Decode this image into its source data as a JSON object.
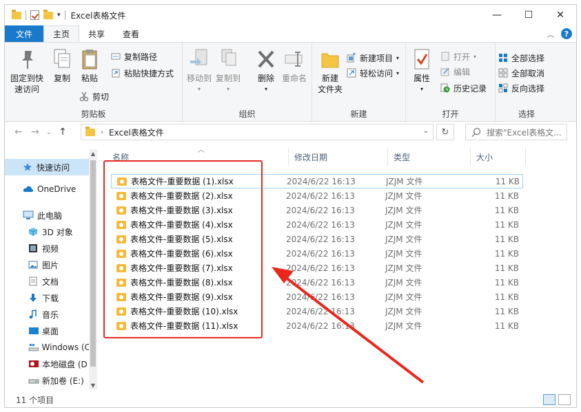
{
  "window": {
    "title": "Excel表格文件"
  },
  "window_controls": {
    "minimize": "—",
    "maximize": "☐",
    "close": "✕"
  },
  "tabs": {
    "file": "文件",
    "home": "主页",
    "share": "共享",
    "view": "查看"
  },
  "ribbon": {
    "clipboard": {
      "label": "剪贴板",
      "pin": "固定到快速访问",
      "pin_line1": "固定到快",
      "pin_line2": "速访问",
      "copy": "复制",
      "paste": "粘贴",
      "copy_path": "复制路径",
      "paste_shortcut": "粘贴快捷方式",
      "cut": "剪切"
    },
    "organize": {
      "label": "组织",
      "move_to": "移动到",
      "copy_to": "复制到",
      "delete": "删除",
      "rename": "重命名"
    },
    "new": {
      "label": "新建",
      "new_folder_line1": "新建",
      "new_folder_line2": "文件夹",
      "new_item": "新建项目",
      "easy_access": "轻松访问"
    },
    "open": {
      "label": "打开",
      "properties": "属性",
      "open": "打开",
      "edit": "编辑",
      "history": "历史记录"
    },
    "select": {
      "label": "选择",
      "select_all": "全部选择",
      "select_none": "全部取消",
      "invert": "反向选择"
    }
  },
  "address": {
    "path": "Excel表格文件",
    "search_placeholder": "搜索\"Excel表格文..."
  },
  "nav": {
    "items": [
      {
        "label": "快速访问",
        "icon": "star-icon"
      },
      {
        "label": "OneDrive",
        "icon": "cloud-icon"
      },
      {
        "label": "此电脑",
        "icon": "computer-icon"
      },
      {
        "label": "3D 对象",
        "icon": "cube-icon"
      },
      {
        "label": "视频",
        "icon": "video-icon"
      },
      {
        "label": "图片",
        "icon": "picture-icon"
      },
      {
        "label": "文档",
        "icon": "document-icon"
      },
      {
        "label": "下载",
        "icon": "download-icon"
      },
      {
        "label": "音乐",
        "icon": "music-icon"
      },
      {
        "label": "桌面",
        "icon": "desktop-icon"
      },
      {
        "label": "Windows (C",
        "icon": "drive-icon"
      },
      {
        "label": "本地磁盘 (D",
        "icon": "disk-icon"
      },
      {
        "label": "新加卷 (E:)",
        "icon": "volume-icon"
      }
    ]
  },
  "columns": {
    "name": "名称",
    "date": "修改日期",
    "type": "类型",
    "size": "大小"
  },
  "files": [
    {
      "name": "表格文件-重要数据 (1).xlsx",
      "date": "2024/6/22 16:13",
      "type": "JZJM 文件",
      "size": "11 KB"
    },
    {
      "name": "表格文件-重要数据 (2).xlsx",
      "date": "2024/6/22 16:13",
      "type": "JZJM 文件",
      "size": "11 KB"
    },
    {
      "name": "表格文件-重要数据 (3).xlsx",
      "date": "2024/6/22 16:13",
      "type": "JZJM 文件",
      "size": "11 KB"
    },
    {
      "name": "表格文件-重要数据 (4).xlsx",
      "date": "2024/6/22 16:13",
      "type": "JZJM 文件",
      "size": "11 KB"
    },
    {
      "name": "表格文件-重要数据 (5).xlsx",
      "date": "2024/6/22 16:13",
      "type": "JZJM 文件",
      "size": "11 KB"
    },
    {
      "name": "表格文件-重要数据 (6).xlsx",
      "date": "2024/6/22 16:13",
      "type": "JZJM 文件",
      "size": "11 KB"
    },
    {
      "name": "表格文件-重要数据 (7).xlsx",
      "date": "2024/6/22 16:13",
      "type": "JZJM 文件",
      "size": "11 KB"
    },
    {
      "name": "表格文件-重要数据 (8).xlsx",
      "date": "2024/6/22 16:13",
      "type": "JZJM 文件",
      "size": "11 KB"
    },
    {
      "name": "表格文件-重要数据 (9).xlsx",
      "date": "2024/6/22 16:13",
      "type": "JZJM 文件",
      "size": "11 KB"
    },
    {
      "name": "表格文件-重要数据 (10).xlsx",
      "date": "2024/6/22 16:13",
      "type": "JZJM 文件",
      "size": "11 KB"
    },
    {
      "name": "表格文件-重要数据 (11).xlsx",
      "date": "2024/6/22 16:13",
      "type": "JZJM 文件",
      "size": "11 KB"
    }
  ],
  "status": {
    "item_count": "11 个项目"
  },
  "colors": {
    "accent": "#1979ca",
    "annotation": "#e8281d",
    "selection": "#cce4f7"
  }
}
